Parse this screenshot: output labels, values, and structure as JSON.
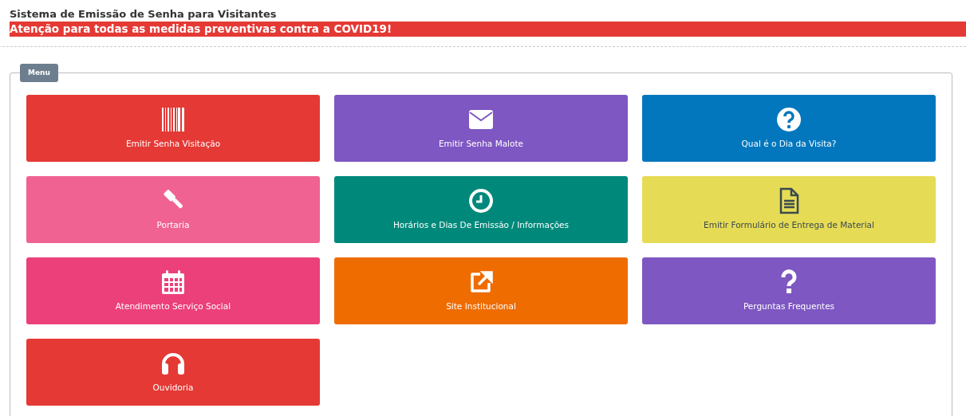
{
  "page_title": "Sistema de Emissão de Senha para Visitantes",
  "alert": "Atenção para todas as medidas preventivas contra a COVID19!",
  "menu": {
    "legend": "Menu",
    "tiles": [
      {
        "label": "Emitir Senha Visitação",
        "color": "#e53935"
      },
      {
        "label": "Emitir Senha Malote",
        "color": "#7e57c2"
      },
      {
        "label": "Qual é o Dia da Visita?",
        "color": "#0277bd"
      },
      {
        "label": "Portaria",
        "color": "#f06292"
      },
      {
        "label": "Horários e Dias De Emissão / Informações",
        "color": "#00897b"
      },
      {
        "label": "Emitir Formulário de Entrega de Material",
        "color": "#e6db55"
      },
      {
        "label": "Atendimento Serviço Social",
        "color": "#ec407a"
      },
      {
        "label": "Site Institucional",
        "color": "#ef6c00"
      },
      {
        "label": "Perguntas Frequentes",
        "color": "#7e57c2"
      },
      {
        "label": "Ouvidoria",
        "color": "#e53935"
      }
    ]
  }
}
